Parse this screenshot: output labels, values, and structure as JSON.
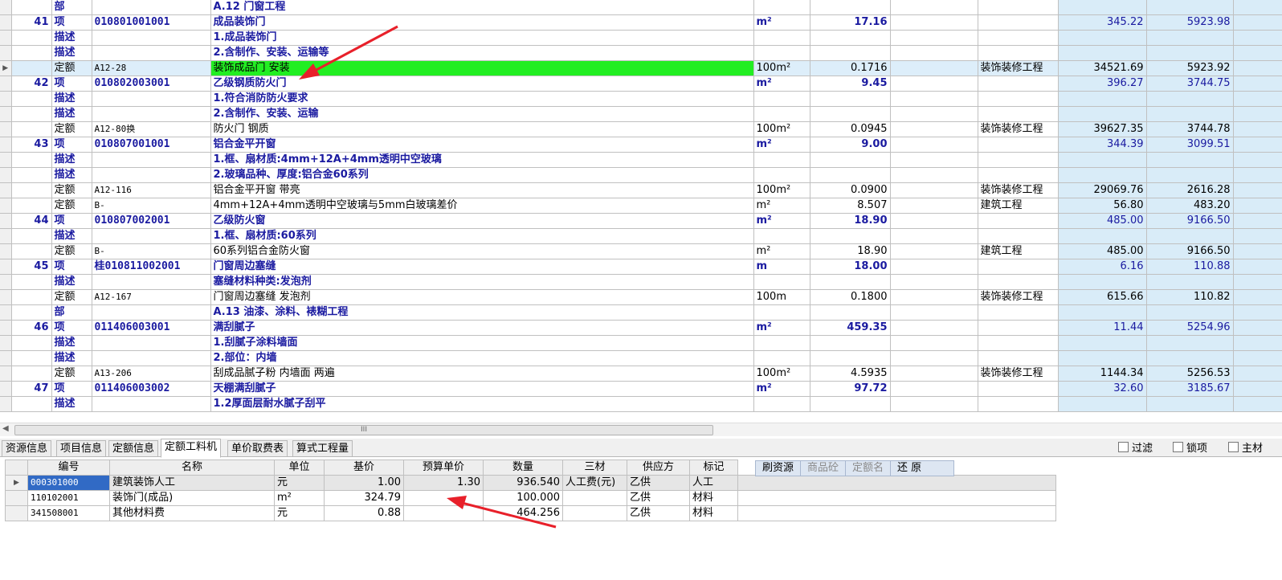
{
  "main_rows": [
    {
      "kind": "part",
      "seq": "",
      "type": "部",
      "code": "",
      "name": "A.12 门窗工程",
      "unit": "",
      "qty": "",
      "extra": "",
      "cat": "",
      "price": "",
      "total": ""
    },
    {
      "kind": "item",
      "seq": "41",
      "type": "项",
      "code": "010801001001",
      "name": "成品装饰门",
      "unit": "m²",
      "qty": "17.16",
      "extra": "",
      "cat": "",
      "price": "345.22",
      "total": "5923.98"
    },
    {
      "kind": "desc",
      "seq": "",
      "type": "描述",
      "code": "",
      "name": "1.成品装饰门",
      "unit": "",
      "qty": "",
      "extra": "",
      "cat": "",
      "price": "",
      "total": ""
    },
    {
      "kind": "desc",
      "seq": "",
      "type": "描述",
      "code": "",
      "name": "2.含制作、安装、运输等",
      "unit": "",
      "qty": "",
      "extra": "",
      "cat": "",
      "price": "",
      "total": ""
    },
    {
      "kind": "quota",
      "selected": true,
      "seq": "",
      "type": "定额",
      "code": "A12-28",
      "name": "装饰成品门 安装",
      "unit": "100m²",
      "qty": "0.1716",
      "extra": "",
      "cat": "装饰装修工程",
      "price": "34521.69",
      "total": "5923.92"
    },
    {
      "kind": "item",
      "seq": "42",
      "type": "项",
      "code": "010802003001",
      "name": "乙级钢质防火门",
      "unit": "m²",
      "qty": "9.45",
      "extra": "",
      "cat": "",
      "price": "396.27",
      "total": "3744.75"
    },
    {
      "kind": "desc",
      "seq": "",
      "type": "描述",
      "code": "",
      "name": "1.符合消防防火要求",
      "unit": "",
      "qty": "",
      "extra": "",
      "cat": "",
      "price": "",
      "total": ""
    },
    {
      "kind": "desc",
      "seq": "",
      "type": "描述",
      "code": "",
      "name": "2.含制作、安装、运输",
      "unit": "",
      "qty": "",
      "extra": "",
      "cat": "",
      "price": "",
      "total": ""
    },
    {
      "kind": "quota",
      "seq": "",
      "type": "定额",
      "code": "A12-80换",
      "name": "防火门 钢质",
      "unit": "100m²",
      "qty": "0.0945",
      "extra": "",
      "cat": "装饰装修工程",
      "price": "39627.35",
      "total": "3744.78"
    },
    {
      "kind": "item",
      "seq": "43",
      "type": "项",
      "code": "010807001001",
      "name": "铝合金平开窗",
      "unit": "m²",
      "qty": "9.00",
      "extra": "",
      "cat": "",
      "price": "344.39",
      "total": "3099.51"
    },
    {
      "kind": "desc",
      "seq": "",
      "type": "描述",
      "code": "",
      "name": "1.框、扇材质:4mm+12A+4mm透明中空玻璃",
      "unit": "",
      "qty": "",
      "extra": "",
      "cat": "",
      "price": "",
      "total": ""
    },
    {
      "kind": "desc",
      "seq": "",
      "type": "描述",
      "code": "",
      "name": "2.玻璃品种、厚度:铝合金60系列",
      "unit": "",
      "qty": "",
      "extra": "",
      "cat": "",
      "price": "",
      "total": ""
    },
    {
      "kind": "quota",
      "seq": "",
      "type": "定额",
      "code": "A12-116",
      "name": "铝合金平开窗 带亮",
      "unit": "100m²",
      "qty": "0.0900",
      "extra": "",
      "cat": "装饰装修工程",
      "price": "29069.76",
      "total": "2616.28"
    },
    {
      "kind": "quota",
      "seq": "",
      "type": "定额",
      "code": "B-",
      "name": "4mm+12A+4mm透明中空玻璃与5mm白玻璃差价",
      "unit": "m²",
      "qty": "8.507",
      "extra": "",
      "cat": "建筑工程",
      "price": "56.80",
      "total": "483.20"
    },
    {
      "kind": "item",
      "seq": "44",
      "type": "项",
      "code": "010807002001",
      "name": "乙级防火窗",
      "unit": "m²",
      "qty": "18.90",
      "extra": "",
      "cat": "",
      "price": "485.00",
      "total": "9166.50"
    },
    {
      "kind": "desc",
      "seq": "",
      "type": "描述",
      "code": "",
      "name": "1.框、扇材质:60系列",
      "unit": "",
      "qty": "",
      "extra": "",
      "cat": "",
      "price": "",
      "total": ""
    },
    {
      "kind": "quota",
      "seq": "",
      "type": "定额",
      "code": "B-",
      "name": "60系列铝合金防火窗",
      "unit": "m²",
      "qty": "18.90",
      "extra": "",
      "cat": "建筑工程",
      "price": "485.00",
      "total": "9166.50"
    },
    {
      "kind": "item",
      "seq": "45",
      "type": "项",
      "code": "桂010811002001",
      "name": "门窗周边塞缝",
      "unit": "m",
      "qty": "18.00",
      "extra": "",
      "cat": "",
      "price": "6.16",
      "total": "110.88"
    },
    {
      "kind": "desc",
      "seq": "",
      "type": "描述",
      "code": "",
      "name": "塞缝材料种类:发泡剂",
      "unit": "",
      "qty": "",
      "extra": "",
      "cat": "",
      "price": "",
      "total": ""
    },
    {
      "kind": "quota",
      "seq": "",
      "type": "定额",
      "code": "A12-167",
      "name": "门窗周边塞缝 发泡剂",
      "unit": "100m",
      "qty": "0.1800",
      "extra": "",
      "cat": "装饰装修工程",
      "price": "615.66",
      "total": "110.82"
    },
    {
      "kind": "part",
      "seq": "",
      "type": "部",
      "code": "",
      "name": "A.13 油漆、涂料、裱糊工程",
      "unit": "",
      "qty": "",
      "extra": "",
      "cat": "",
      "price": "",
      "total": ""
    },
    {
      "kind": "item",
      "seq": "46",
      "type": "项",
      "code": "011406003001",
      "name": "满刮腻子",
      "unit": "m²",
      "qty": "459.35",
      "extra": "",
      "cat": "",
      "price": "11.44",
      "total": "5254.96"
    },
    {
      "kind": "desc",
      "seq": "",
      "type": "描述",
      "code": "",
      "name": "1.刮腻子涂料墙面",
      "unit": "",
      "qty": "",
      "extra": "",
      "cat": "",
      "price": "",
      "total": ""
    },
    {
      "kind": "desc",
      "seq": "",
      "type": "描述",
      "code": "",
      "name": "2.部位：内墙",
      "unit": "",
      "qty": "",
      "extra": "",
      "cat": "",
      "price": "",
      "total": ""
    },
    {
      "kind": "quota",
      "seq": "",
      "type": "定额",
      "code": "A13-206",
      "name": "刮成品腻子粉 内墙面 两遍",
      "unit": "100m²",
      "qty": "4.5935",
      "extra": "",
      "cat": "装饰装修工程",
      "price": "1144.34",
      "total": "5256.53"
    },
    {
      "kind": "item",
      "seq": "47",
      "type": "项",
      "code": "011406003002",
      "name": "天棚满刮腻子",
      "unit": "m²",
      "qty": "97.72",
      "extra": "",
      "cat": "",
      "price": "32.60",
      "total": "3185.67"
    },
    {
      "kind": "desc",
      "seq": "",
      "type": "描述",
      "code": "",
      "name": "1.2厚面层耐水腻子刮平",
      "unit": "",
      "qty": "",
      "extra": "",
      "cat": "",
      "price": "",
      "total": ""
    }
  ],
  "tabs": [
    "资源信息",
    "项目信息",
    "定额信息",
    "定额工料机",
    "单价取费表",
    "算式工程量"
  ],
  "active_tab": 3,
  "checks": {
    "filter": "过滤",
    "lock": "锁项",
    "main": "主材"
  },
  "sub_headers": [
    "编号",
    "名称",
    "单位",
    "基价",
    "预算单价",
    "数量",
    "三材",
    "供应方",
    "标记"
  ],
  "sub_rows": [
    {
      "code": "000301000",
      "name": "建筑装饰人工",
      "unit": "元",
      "base": "1.00",
      "budget": "1.30",
      "qty": "936.540",
      "mat": "人工费(元)",
      "supplier": "乙供",
      "mark": "人工"
    },
    {
      "code": "110102001",
      "name": "装饰门(成品)",
      "unit": "m²",
      "base": "324.79",
      "budget": "",
      "qty": "100.000",
      "mat": "",
      "supplier": "乙供",
      "mark": "材料"
    },
    {
      "code": "341508001",
      "name": "其他材料费",
      "unit": "元",
      "base": "0.88",
      "budget": "",
      "qty": "464.256",
      "mat": "",
      "supplier": "乙供",
      "mark": "材料"
    }
  ],
  "context_buttons": [
    "刷资源",
    "商品砼",
    "定额名",
    "还 原"
  ],
  "scroll_thumb": "III"
}
